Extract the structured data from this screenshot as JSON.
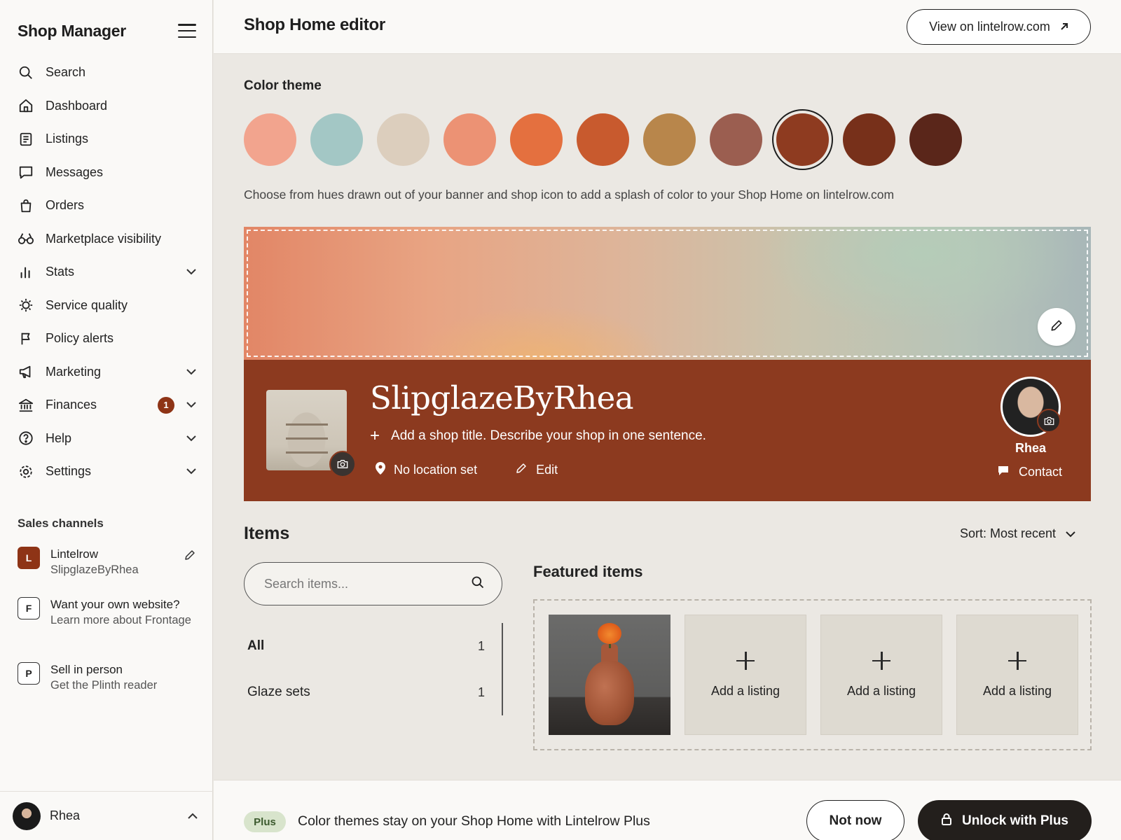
{
  "sidebar": {
    "title": "Shop Manager",
    "nav": [
      {
        "label": "Search",
        "icon": "search-icon",
        "chevron": false
      },
      {
        "label": "Dashboard",
        "icon": "home-icon",
        "chevron": false
      },
      {
        "label": "Listings",
        "icon": "listings-icon",
        "chevron": false
      },
      {
        "label": "Messages",
        "icon": "message-icon",
        "chevron": false
      },
      {
        "label": "Orders",
        "icon": "bag-icon",
        "chevron": false
      },
      {
        "label": "Marketplace visibility",
        "icon": "binoculars-icon",
        "chevron": false
      },
      {
        "label": "Stats",
        "icon": "bar-chart-icon",
        "chevron": true
      },
      {
        "label": "Service quality",
        "icon": "badge-check-icon",
        "chevron": false
      },
      {
        "label": "Policy alerts",
        "icon": "flag-icon",
        "chevron": false
      },
      {
        "label": "Marketing",
        "icon": "megaphone-icon",
        "chevron": true
      },
      {
        "label": "Finances",
        "icon": "bank-icon",
        "chevron": true,
        "badge": "1"
      },
      {
        "label": "Help",
        "icon": "help-icon",
        "chevron": true
      },
      {
        "label": "Settings",
        "icon": "gear-icon",
        "chevron": true
      }
    ],
    "sales_channels_title": "Sales channels",
    "channels": [
      {
        "initial": "L",
        "name": "Lintelrow",
        "sub": "SlipglazeByRhea"
      },
      {
        "initial": "F",
        "name": "Want your own website?",
        "sub": "Learn more about Frontage"
      },
      {
        "initial": "P",
        "name": "Sell in person",
        "sub": "Get the Plinth reader"
      }
    ],
    "user_name": "Rhea"
  },
  "header": {
    "title": "Shop Home editor",
    "view_label": "View on lintelrow.com"
  },
  "color_theme": {
    "title": "Color theme",
    "swatches": [
      "#f2a48e",
      "#a3c7c5",
      "#dccebd",
      "#ec9274",
      "#e4703f",
      "#c85a2e",
      "#b8864b",
      "#9b5e50",
      "#8e3b20",
      "#77301a",
      "#5a261a"
    ],
    "selected_index": 8,
    "description": "Choose from hues drawn out of your banner and shop icon to add a splash of color to your Shop Home on lintelrow.com"
  },
  "shop": {
    "name": "SlipglazeByRhea",
    "description_prompt": "Add a shop title. Describe your shop in one sentence.",
    "location": "No location set",
    "edit_label": "Edit",
    "owner_name": "Rhea",
    "contact_label": "Contact",
    "strip_color": "#8c3a1f"
  },
  "items": {
    "title": "Items",
    "sort_label": "Sort: Most recent",
    "search_placeholder": "Search items...",
    "categories": [
      {
        "label": "All",
        "count": "1"
      },
      {
        "label": "Glaze sets",
        "count": "1"
      }
    ],
    "featured_title": "Featured items",
    "add_listing_label": "Add a listing"
  },
  "promo": {
    "pill": "Plus",
    "text": "Color themes stay on your Shop Home with Lintelrow Plus",
    "not_now_label": "Not now",
    "unlock_label": "Unlock with Plus"
  }
}
